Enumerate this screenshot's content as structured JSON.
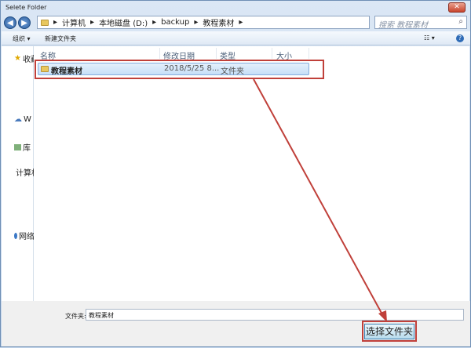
{
  "window": {
    "title": "Selete Folder",
    "close": "✕"
  },
  "nav": {
    "back": "◀",
    "forward": "▶"
  },
  "breadcrumb": [
    "计算机",
    "本地磁盘 (D:)",
    "backup",
    "教程素材"
  ],
  "search": {
    "placeholder": "搜索 教程素材",
    "icon": "⌕"
  },
  "toolbar": {
    "organize": "组织 ▾",
    "new_folder": "新建文件夹",
    "view": "☷ ▾",
    "help": "?"
  },
  "sidebar": [
    {
      "label": "收藏夹",
      "icon": "star-icon"
    },
    {
      "label": "W",
      "icon": "cloud-icon"
    },
    {
      "label": "库",
      "icon": "library-icon"
    },
    {
      "label": "计算机",
      "icon": "computer-icon"
    },
    {
      "label": "网络",
      "icon": "network-icon"
    }
  ],
  "columns": [
    "名称",
    "修改日期",
    "类型",
    "大小"
  ],
  "rows": [
    {
      "name": "教程素材",
      "date": "2018/5/25 8...",
      "type": "文件夹",
      "size": ""
    }
  ],
  "footer": {
    "folder_label": "文件夹:",
    "folder_value": "教程素材",
    "select_button": "选择文件夹"
  },
  "colors": {
    "highlight": "#c0403a"
  }
}
